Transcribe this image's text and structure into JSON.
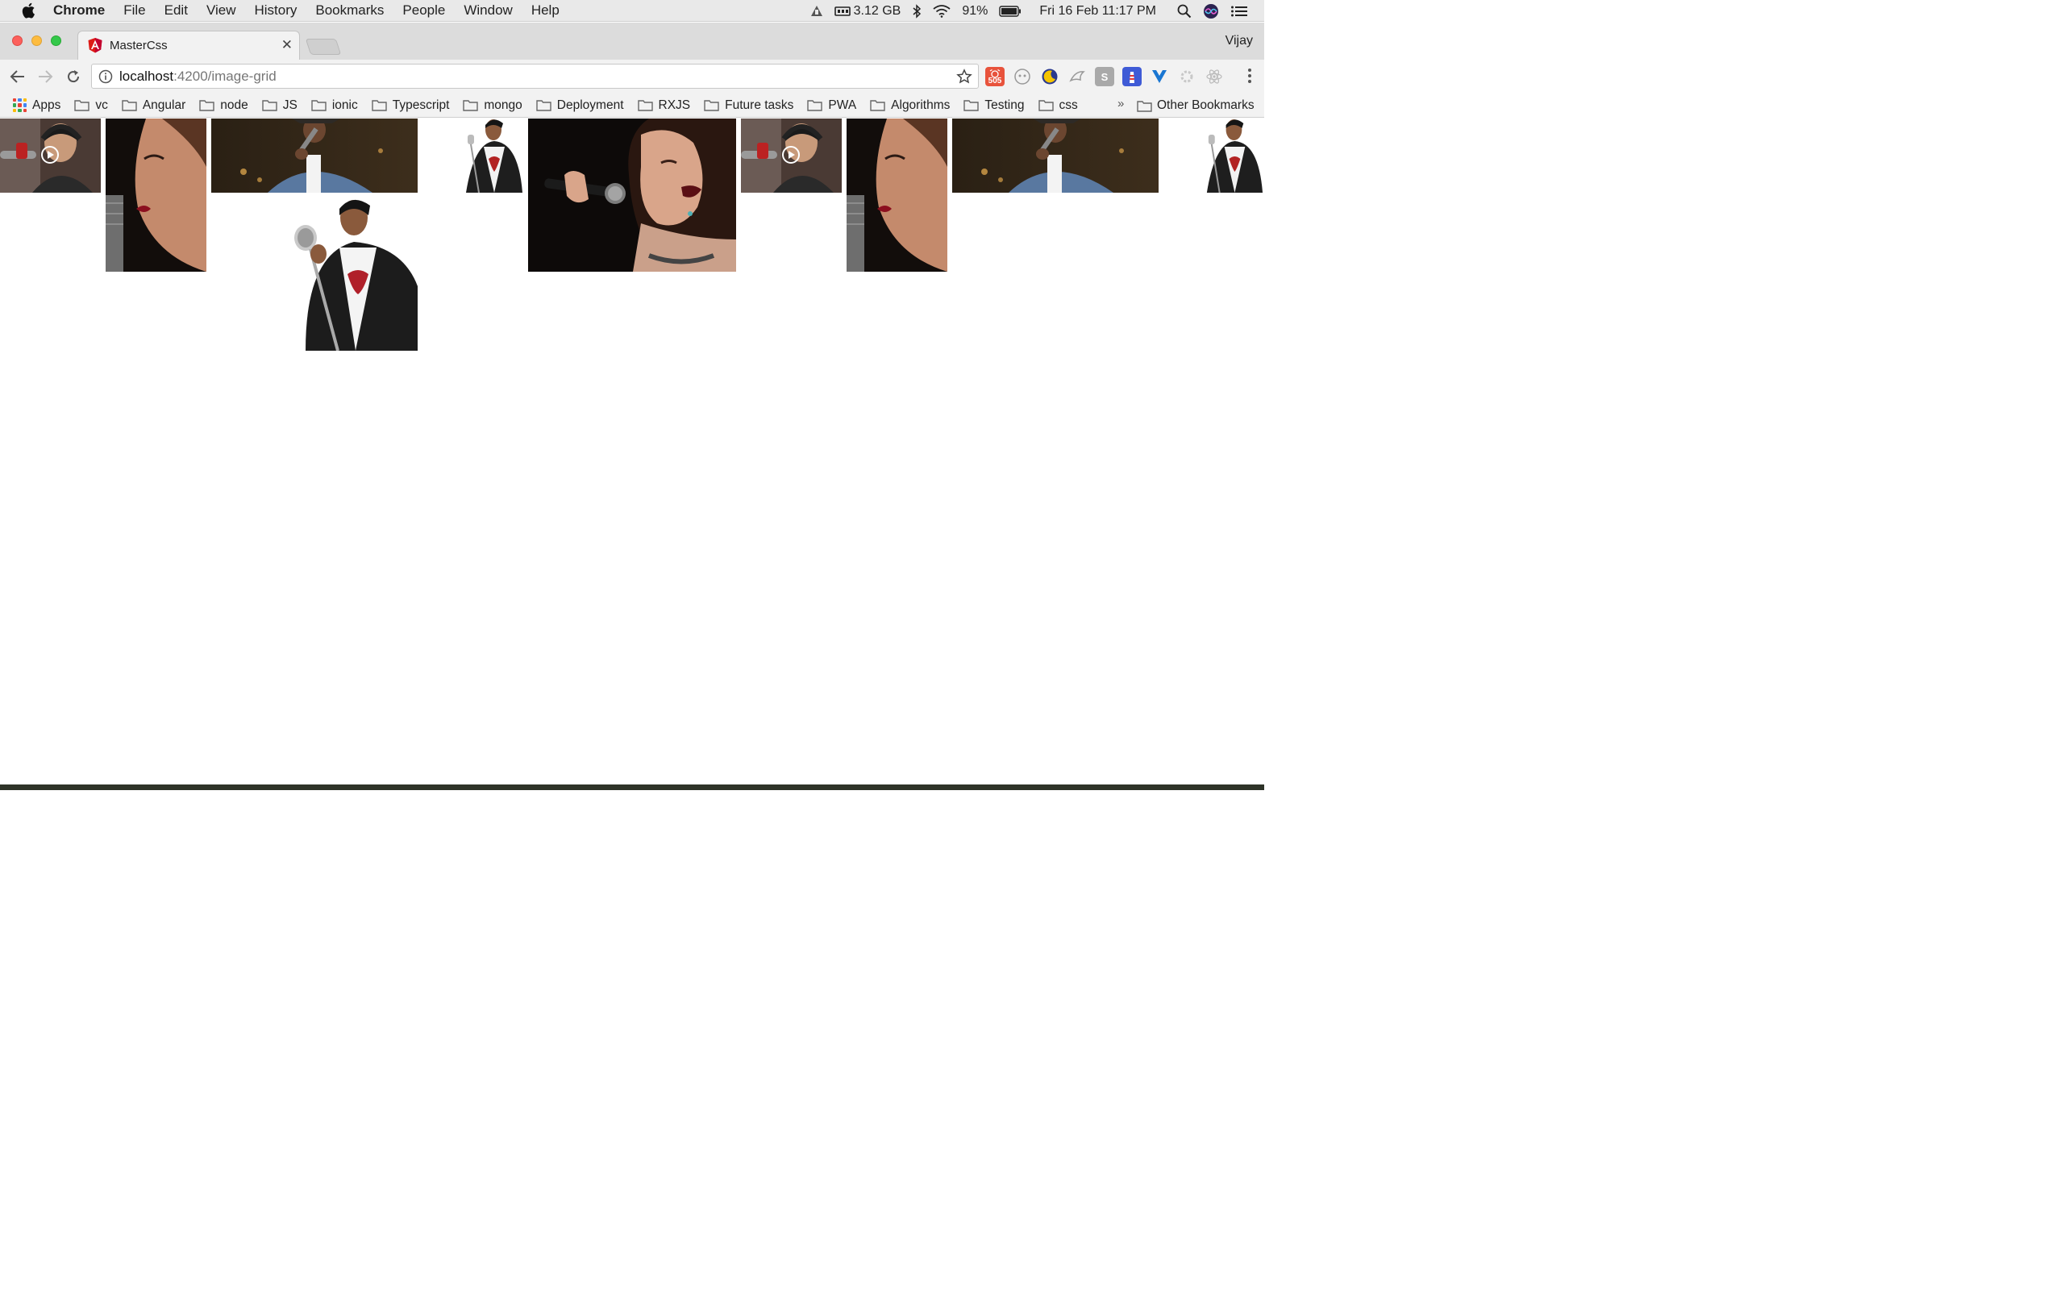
{
  "menubar": {
    "items": [
      "Chrome",
      "File",
      "Edit",
      "View",
      "History",
      "Bookmarks",
      "People",
      "Window",
      "Help"
    ],
    "memory": "3.12 GB",
    "battery": "91%",
    "datetime": "Fri 16 Feb  11:17 PM"
  },
  "tab": {
    "title": "MasterCss"
  },
  "profile": {
    "name": "Vijay"
  },
  "omnibox": {
    "host": "localhost",
    "path": ":4200/image-grid"
  },
  "extensions": {
    "badge": "505"
  },
  "bookmarks": {
    "apps_label": "Apps",
    "folders": [
      "vc",
      "Angular",
      "node",
      "JS",
      "ionic",
      "Typescript",
      "mongo",
      "Deployment",
      "RXJS",
      "Future tasks",
      "PWA",
      "Algorithms",
      "Testing",
      "css"
    ],
    "other": "Other Bookmarks"
  },
  "colors": {
    "close": "#fc605c",
    "minimize": "#fdbc40",
    "maximize": "#34c84a",
    "angular_red": "#dd1b16"
  },
  "grid": {
    "images": [
      "singer-headphones-play",
      "woman-closeup-red-lips",
      "man-singing-hat",
      "man-suit-mic-small",
      "woman-singing-microphone",
      "singer-headphones-play",
      "woman-closeup-red-lips",
      "man-singing-hat",
      "man-suit-mic-small",
      "man-suit-vintage-mic"
    ]
  }
}
